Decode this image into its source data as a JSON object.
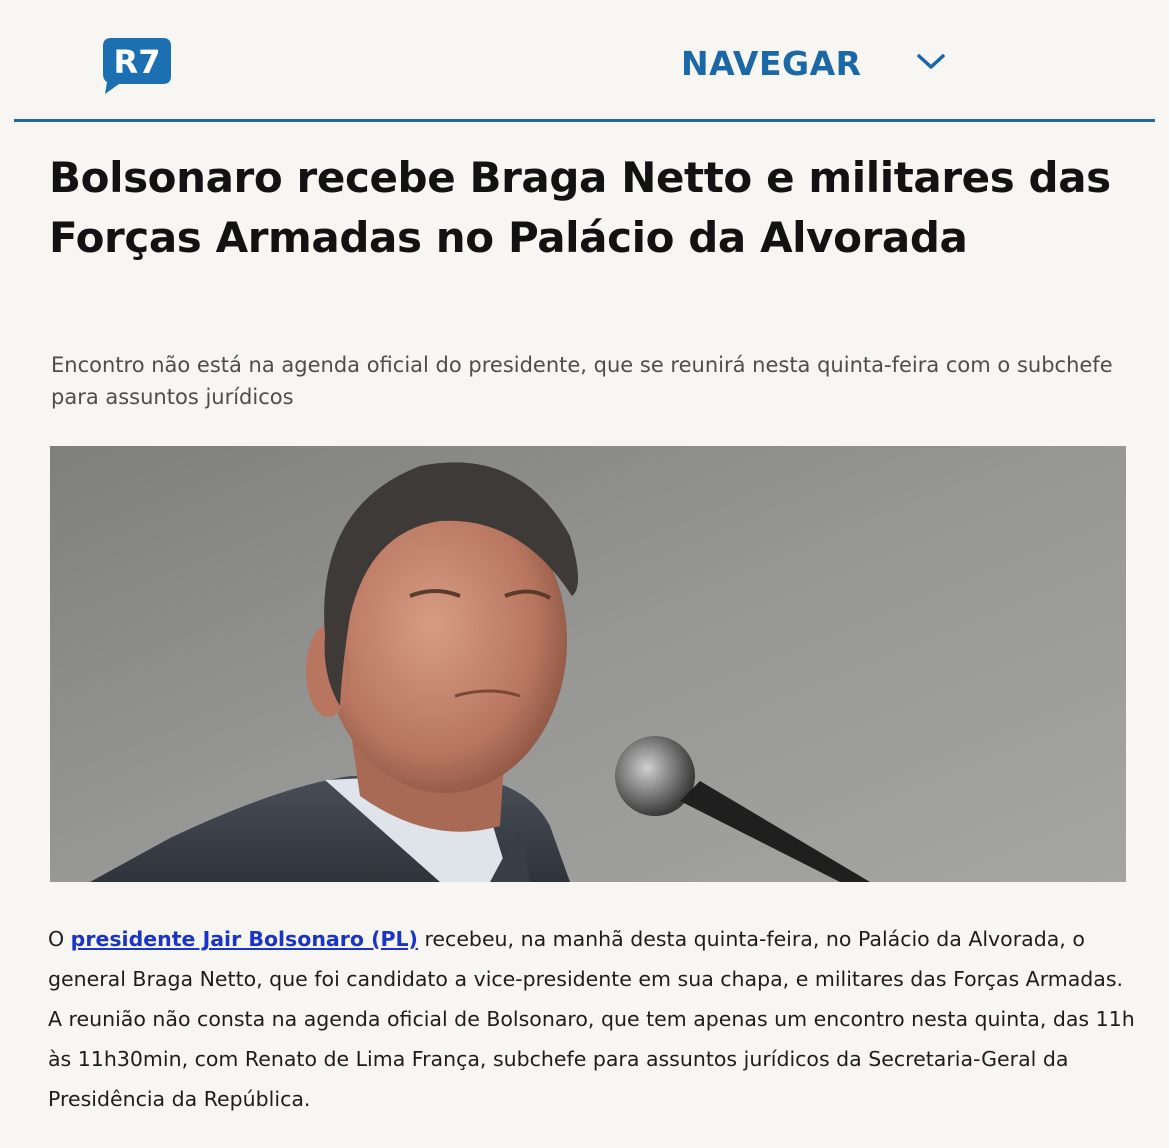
{
  "header": {
    "logo_text": "R7",
    "nav_label": "NAVEGAR",
    "nav_icon": "chevron-down-icon"
  },
  "article": {
    "headline": "Bolsonaro recebe Braga Netto e militares das Forças Armadas no Palácio da Alvorada",
    "subtitle": "Encontro não está na agenda oficial do presidente, que se reunirá nesta quinta-feira com o subchefe para assuntos jurídicos",
    "body_prefix": "O ",
    "body_link": "presidente Jair Bolsonaro (PL)",
    "body_rest": " recebeu, na manhã desta quinta-feira, no Palácio da Alvorada, o general Braga Netto, que foi candidato a vice-presidente em sua chapa, e militares das Forças Armadas. A reunião não consta na agenda oficial de Bolsonaro, que tem apenas um encontro nesta quinta, das 11h às 11h30min, com Renato de Lima França, subchefe para assuntos jurídicos da Secretaria-Geral da Presidência da República."
  },
  "colors": {
    "brand_blue": "#1a68a8",
    "link_blue": "#1a33c9",
    "headline": "#121212"
  }
}
